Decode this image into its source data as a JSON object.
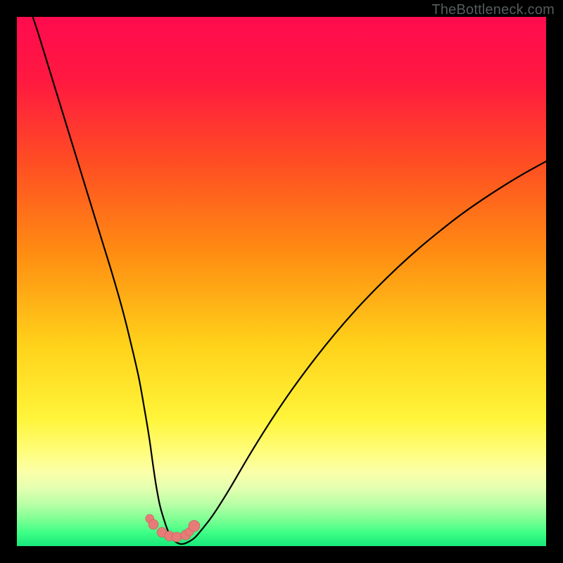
{
  "watermark": {
    "text": "TheBottleneck.com"
  },
  "colors": {
    "black": "#000000",
    "gradient_stops": [
      {
        "offset": 0.0,
        "color": "#ff0b4f"
      },
      {
        "offset": 0.12,
        "color": "#ff1940"
      },
      {
        "offset": 0.28,
        "color": "#ff4f22"
      },
      {
        "offset": 0.45,
        "color": "#ff8e12"
      },
      {
        "offset": 0.62,
        "color": "#ffd21a"
      },
      {
        "offset": 0.76,
        "color": "#fff53a"
      },
      {
        "offset": 0.82,
        "color": "#fffd7a"
      },
      {
        "offset": 0.86,
        "color": "#fbffa8"
      },
      {
        "offset": 0.89,
        "color": "#e4ffb0"
      },
      {
        "offset": 0.92,
        "color": "#baffa6"
      },
      {
        "offset": 0.95,
        "color": "#7cff94"
      },
      {
        "offset": 0.975,
        "color": "#3dff86"
      },
      {
        "offset": 1.0,
        "color": "#17e77a"
      }
    ],
    "curve": "#000000",
    "marker_face": "#e77b78",
    "marker_edge": "#c95a58"
  },
  "chart_data": {
    "type": "line",
    "title": "",
    "xlabel": "",
    "ylabel": "",
    "xlim": [
      0,
      100
    ],
    "ylim": [
      0,
      100
    ],
    "series": [
      {
        "name": "bottleneck-curve",
        "x": [
          3,
          4,
          6,
          8,
          10,
          12,
          14,
          16,
          18,
          20,
          21.5,
          23,
          24,
          25,
          25.7,
          26.3,
          27,
          27.8,
          28.5,
          29.2,
          30,
          31,
          32,
          33.5,
          35,
          37,
          40,
          44,
          48,
          52,
          56,
          60,
          64,
          68,
          72,
          76,
          80,
          84,
          88,
          92,
          96,
          100
        ],
        "y": [
          100,
          97,
          90.5,
          84,
          77.5,
          71,
          64.5,
          58,
          51.5,
          44.5,
          38.5,
          32,
          26.5,
          20.5,
          15.5,
          11.5,
          7.8,
          5,
          3,
          1.7,
          0.8,
          0.4,
          0.6,
          1.5,
          3.2,
          5.8,
          10.5,
          17.3,
          23.7,
          29.6,
          35,
          40,
          44.6,
          48.8,
          52.7,
          56.3,
          59.6,
          62.7,
          65.5,
          68.1,
          70.5,
          72.7
        ]
      }
    ],
    "markers": {
      "name": "highlight-points",
      "x": [
        25.1,
        25.8,
        27.4,
        28.8,
        30.2,
        31.9,
        32.6,
        33.5
      ],
      "y": [
        5.2,
        4.1,
        2.6,
        1.9,
        1.7,
        2.1,
        2.7,
        3.8
      ],
      "r": [
        6,
        7,
        7,
        7,
        7,
        7,
        6,
        8
      ]
    }
  }
}
